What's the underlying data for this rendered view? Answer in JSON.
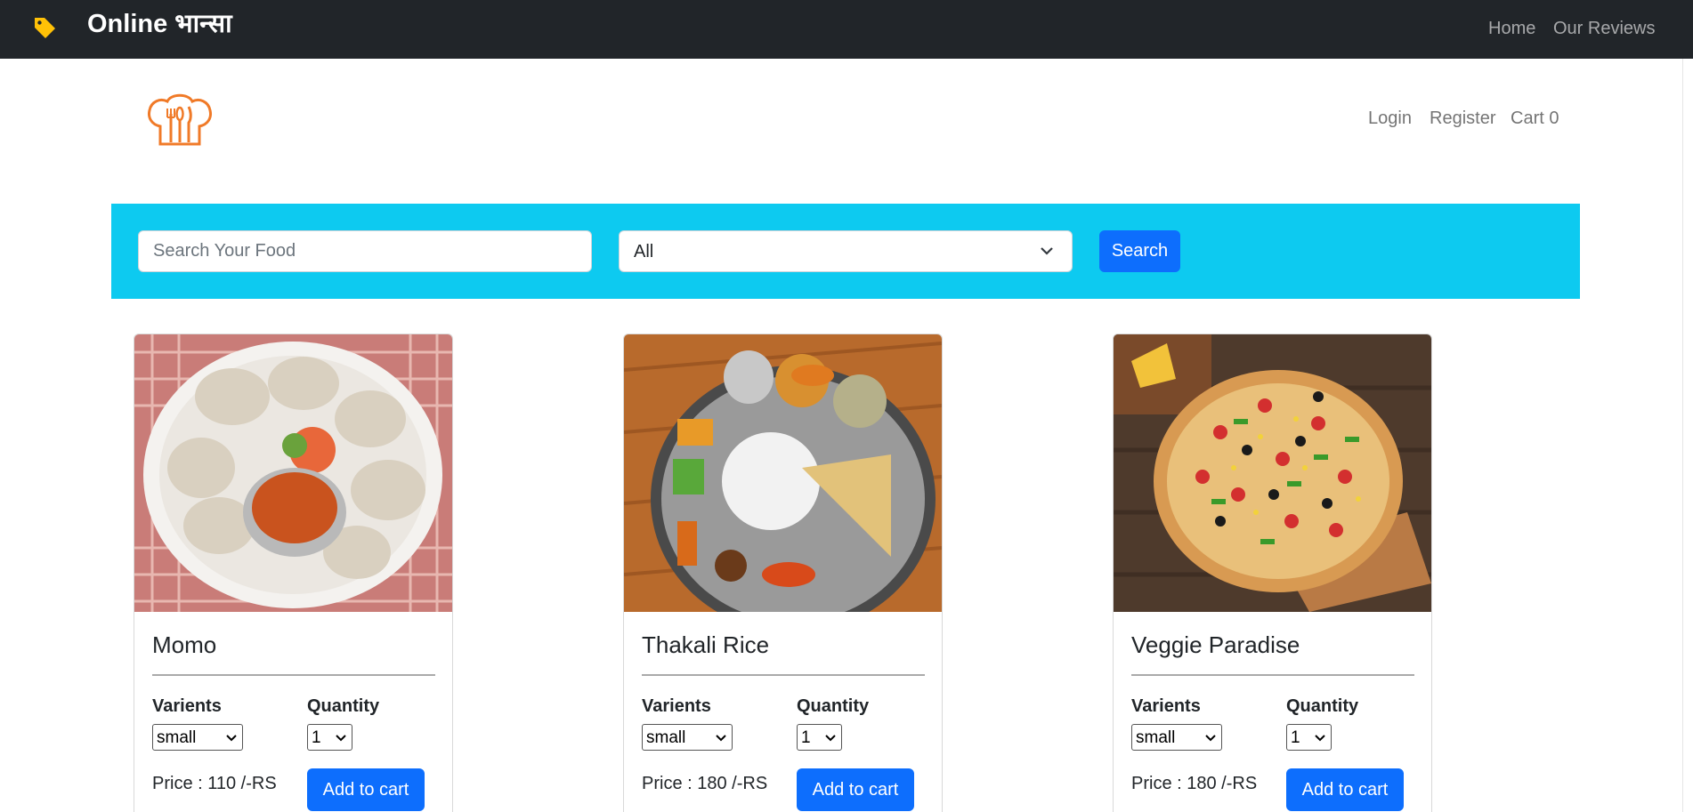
{
  "topbar": {
    "brand_title": "Online भान्सा",
    "nav": [
      "Home",
      "Our Reviews"
    ]
  },
  "header": {
    "nav": [
      "Login",
      "Register",
      "Cart 0"
    ]
  },
  "search": {
    "placeholder": "Search Your Food",
    "category_selected": "All",
    "button_label": "Search"
  },
  "products": [
    {
      "name": "Momo",
      "variants_label": "Varients",
      "quantity_label": "Quantity",
      "variant_selected": "small",
      "quantity_selected": "1",
      "price": "Price : 110 /-RS",
      "add_label": "Add to cart"
    },
    {
      "name": "Thakali Rice",
      "variants_label": "Varients",
      "quantity_label": "Quantity",
      "variant_selected": "small",
      "quantity_selected": "1",
      "price": "Price : 180 /-RS",
      "add_label": "Add to cart"
    },
    {
      "name": "Veggie Paradise",
      "variants_label": "Varients",
      "quantity_label": "Quantity",
      "variant_selected": "small",
      "quantity_selected": "1",
      "price": "Price : 180 /-RS",
      "add_label": "Add to cart"
    }
  ],
  "colors": {
    "topbar": "#212529",
    "search_bar": "#0dcaf0",
    "primary": "#0d6efd",
    "tag_icon": "#ffc107",
    "logo": "#f07a28"
  },
  "icons": {
    "brand": "tag-icon",
    "logo": "chef-hat-utensils-icon"
  }
}
